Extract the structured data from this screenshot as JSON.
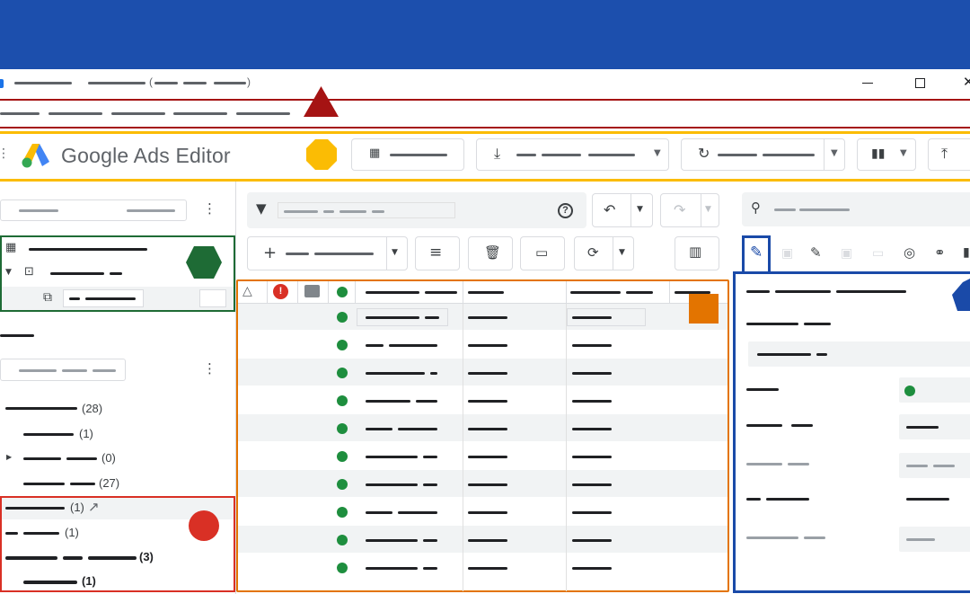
{
  "app": {
    "logo_text": "Google Ads Editor",
    "brand_colors": {
      "blue": "#1c4fad",
      "yellow": "#fbbc04",
      "green": "#34a853",
      "red": "#ea4335"
    }
  },
  "window": {
    "controls": [
      "minimize-icon",
      "maximize-icon",
      "close-icon"
    ]
  },
  "toolbar": {
    "icons": [
      "menu-icon",
      "grid-icon",
      "download-icon",
      "chevron-down-icon",
      "refresh-icon",
      "chart-icon",
      "upload-icon"
    ]
  },
  "left_tree": {
    "counts": [
      "(28)",
      "(1)",
      "(0)",
      "(27)",
      "(1)",
      "(1)",
      "(3)",
      "(1)"
    ]
  },
  "markers": {
    "colors": {
      "triangle": "#a51313",
      "octagon": "#fbbc04",
      "hexagon": "#1e6b35",
      "square": "#e37400",
      "circle": "#d93025",
      "pentagon": "#1a4aa8"
    }
  },
  "grid": {
    "row_count": 10,
    "status_icons": [
      "warning-icon",
      "error-icon",
      "comment-icon",
      "status-icon"
    ]
  }
}
